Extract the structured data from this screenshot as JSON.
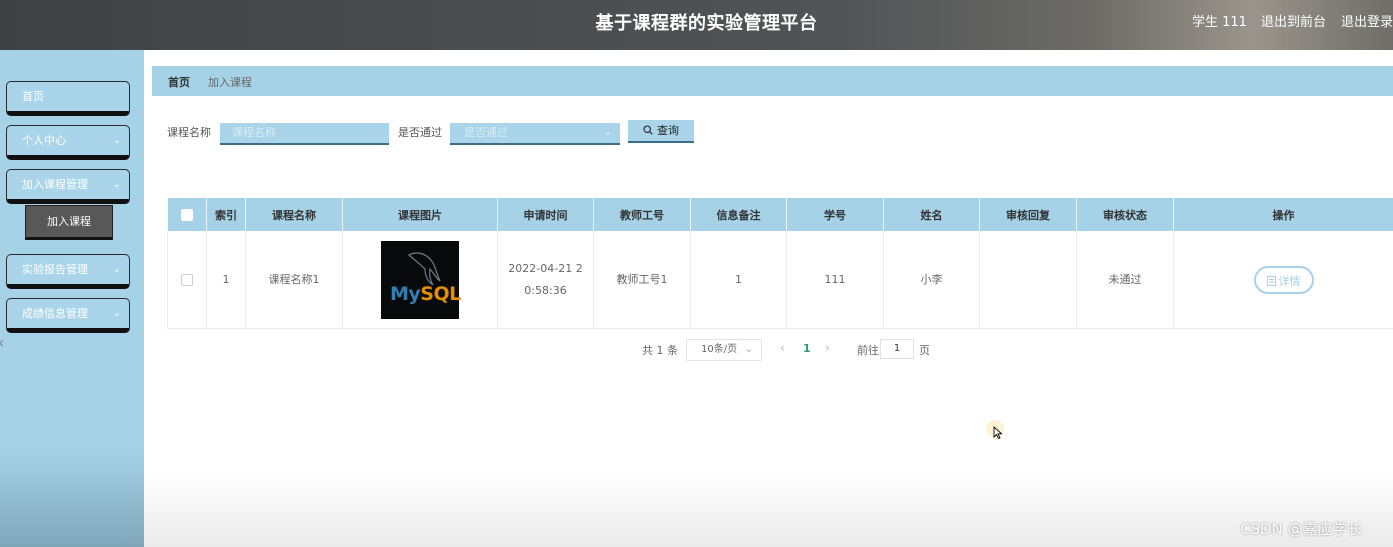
{
  "header": {
    "title": "基于课程群的实验管理平台",
    "user": "学生 111",
    "front_link": "退出到前台",
    "logout_link": "退出登录"
  },
  "sidebar": {
    "items": [
      {
        "label": "首页",
        "has_chevron": false
      },
      {
        "label": "个人中心",
        "has_chevron": true
      },
      {
        "label": "加入课程管理",
        "has_chevron": true
      },
      {
        "label": "实验报告管理",
        "has_chevron": true
      },
      {
        "label": "成绩信息管理",
        "has_chevron": true
      }
    ],
    "submenu_item": "加入课程",
    "chevron": "⌄"
  },
  "breadcrumb": {
    "home": "首页",
    "current": "加入课程"
  },
  "search": {
    "course_name_label": "课程名称",
    "course_name_placeholder": "课程名称",
    "passed_label": "是否通过",
    "passed_placeholder": "是否通过",
    "query_button": "查询"
  },
  "table": {
    "columns": [
      "",
      "索引",
      "课程名称",
      "课程图片",
      "申请时间",
      "教师工号",
      "信息备注",
      "学号",
      "姓名",
      "审核回复",
      "审核状态",
      "操作"
    ],
    "rows": [
      {
        "index": "1",
        "course_name": "课程名称1",
        "image_label_my": "My",
        "image_label_sql": "SQL",
        "apply_time": "2022-04-21 20:58:36",
        "teacher_id": "教师工号1",
        "remark": "1",
        "student_id": "111",
        "name": "小李",
        "review_reply": "",
        "review_status": "未通过",
        "action": "详情"
      }
    ]
  },
  "pagination": {
    "total": "共 1 条",
    "page_size": "10条/页",
    "current_page": "1",
    "goto_label": "前往",
    "goto_value": "1",
    "page_suffix": "页"
  },
  "watermark": "CSDN @嘉应学长"
}
